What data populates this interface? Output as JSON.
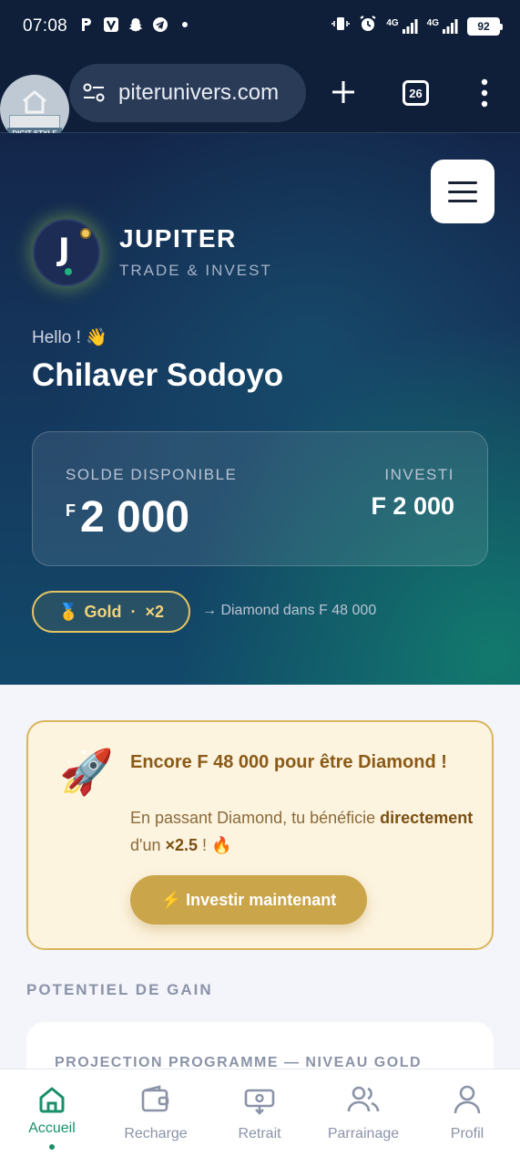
{
  "status_bar": {
    "time": "07:08",
    "battery": "92",
    "network_1": "4G",
    "network_2": "4G"
  },
  "browser": {
    "url": "piterunivers.com",
    "tab_count": "26",
    "home_badge": "DIGIT STYLE"
  },
  "header": {
    "brand_name": "JUPITER",
    "brand_tagline": "TRADE & INVEST",
    "logo_letter": "J"
  },
  "greeting": {
    "hello": "Hello ! 👋",
    "user_name": "Chilaver Sodoyo"
  },
  "balance": {
    "label": "SOLDE DISPONIBLE",
    "currency": "F",
    "amount": "2 000",
    "invested_label": "INVESTI",
    "invested_value": "F 2 000"
  },
  "tier": {
    "medal": "🥇",
    "label": "Gold  ·  ×2",
    "next": "→ Diamond dans F 48 000"
  },
  "promo": {
    "icon": "🚀",
    "title": "Encore F 48 000 pour être Diamond !",
    "text_before": "En passant Diamond, tu bénéficie ",
    "text_bold": "directement",
    "text_mid": " d'un ",
    "text_multiplier": "×2.5",
    "text_after": " ! 🔥",
    "button_label": "⚡ Investir maintenant"
  },
  "gain": {
    "section_title": "POTENTIEL DE GAIN",
    "projection_title": "PROJECTION PROGRAMME — NIVEAU GOLD"
  },
  "bottom_nav": {
    "items": [
      {
        "label": "Accueil",
        "icon": "home-icon",
        "active": true
      },
      {
        "label": "Recharge",
        "icon": "wallet-icon",
        "active": false
      },
      {
        "label": "Retrait",
        "icon": "withdraw-icon",
        "active": false
      },
      {
        "label": "Parrainage",
        "icon": "users-icon",
        "active": false
      },
      {
        "label": "Profil",
        "icon": "user-icon",
        "active": false
      }
    ]
  },
  "colors": {
    "hero_dark": "#13264a",
    "hero_teal": "#12826e",
    "gold": "#e2c463",
    "accent_green": "#1a8f6a",
    "promo_bg": "#fdf4e0",
    "promo_button": "#caa54a"
  }
}
